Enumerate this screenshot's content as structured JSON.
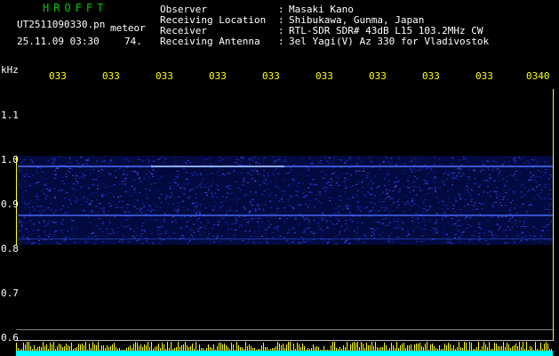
{
  "app": {
    "logo": "HROFFT",
    "filename": "UT2511090330.pn",
    "mode": "meteor",
    "datetime": "25.11.09 03:30",
    "count": "74."
  },
  "header": {
    "rows": [
      {
        "label": "Observer",
        "sep": ":",
        "value": "Masaki Kano"
      },
      {
        "label": "Receiving Location",
        "sep": ":",
        "value": "Shibukawa, Gunma, Japan"
      },
      {
        "label": "Receiver",
        "sep": ":",
        "value": "RTL-SDR SDR# 43dB L15 103.2MHz CW"
      },
      {
        "label": "Receiving Antenna",
        "sep": ":",
        "value": "3el Yagi(V) Az 330 for Vladivostok"
      }
    ]
  },
  "axes": {
    "y_unit": "kHz",
    "y_ticks": [
      "1.1",
      "1.0",
      "0.9",
      "0.8",
      "0.7",
      "0.6"
    ],
    "time_ticks": [
      "033",
      "033",
      "033",
      "033",
      "033",
      "033",
      "033",
      "033",
      "033",
      "0340"
    ]
  },
  "colors": {
    "text": "#ffffff",
    "logo": "#00d000",
    "ticks": "#ffff00",
    "spectrum": "#2040ff",
    "activity": "#ffff00",
    "baseline": "#00ffff"
  }
}
